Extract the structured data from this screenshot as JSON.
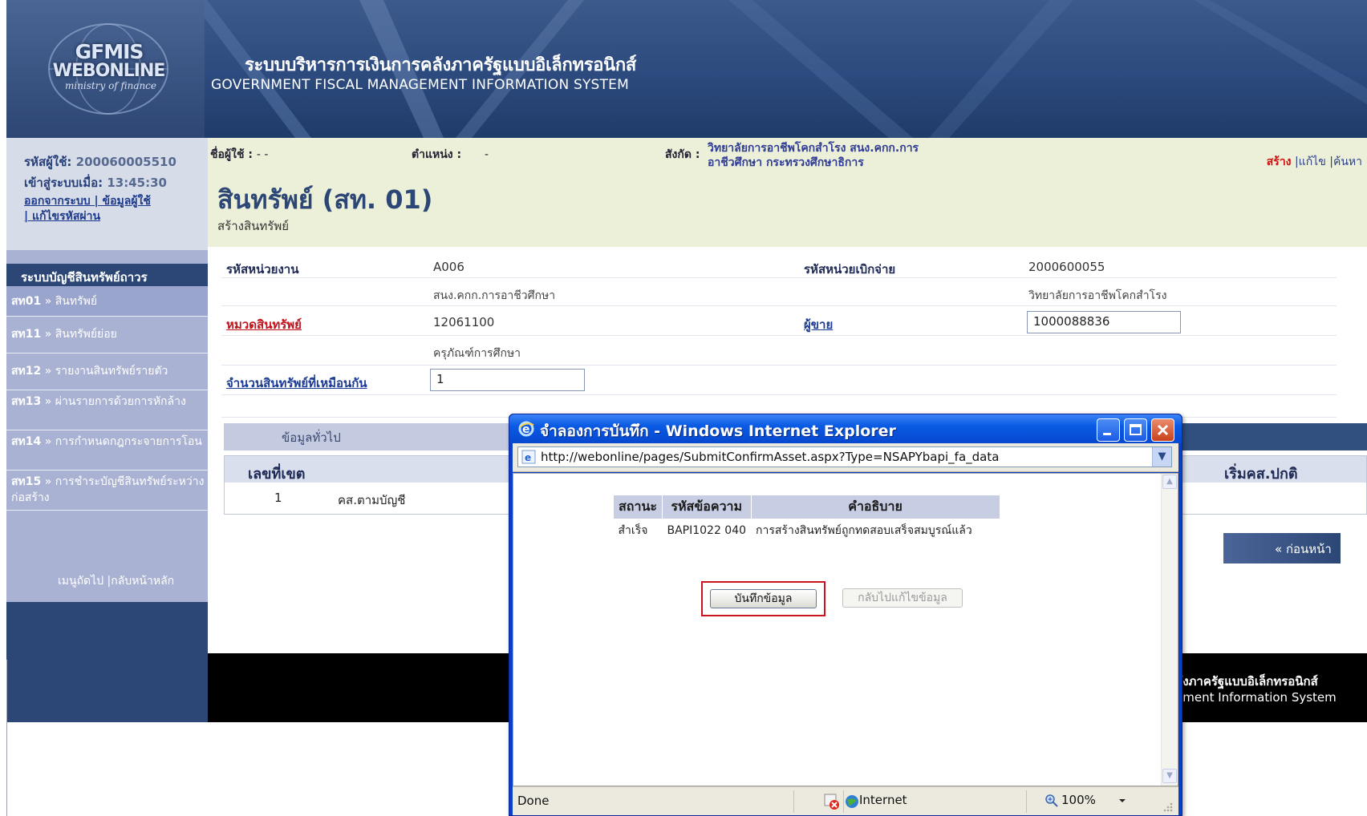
{
  "header": {
    "logo_line1": "GFMIS",
    "logo_line2": "WEBONLINE",
    "logo_line3": "ministry of finance",
    "system_title_th": "ระบบบริหารการเงินการคลังภาครัฐแบบอิเล็กทรอนิกส์",
    "system_title_en": "GOVERNMENT FISCAL MANAGEMENT INFORMATION SYSTEM"
  },
  "sidebar": {
    "user_id_label": "รหัสผู้ใช้:",
    "user_id": "200060005510",
    "login_label": "เข้าสู่ระบบเมื่อ:",
    "login_time": "13:45:30",
    "links_line1": "ออกจากระบบ | ข้อมูลผู้ใช้",
    "links_line2": "| แก้ไขรหัสผ่าน",
    "section_title": "ระบบบัญชีสินทรัพย์ถาวร",
    "items": [
      {
        "code": "สท01",
        "sep": " » ",
        "label": "สินทรัพย์"
      },
      {
        "code": "สท11",
        "sep": " » ",
        "label": "สินทรัพย์ย่อย"
      },
      {
        "code": "สท12",
        "sep": " » ",
        "label": "รายงานสินทรัพย์รายตัว"
      },
      {
        "code": "สท13",
        "sep": " » ",
        "label": "ผ่านรายการด้วยการหักล้าง"
      },
      {
        "code": "สท14",
        "sep": " » ",
        "label": "การกำหนดกฎกระจายการโอน"
      },
      {
        "code": "สท15",
        "sep": " » ",
        "label": "การชำระบัญชีสินทรัพย์ระหว่างก่อสร้าง"
      }
    ],
    "bottom_links": "เมนูถัดไป |กลับหน้าหลัก"
  },
  "userbar": {
    "username_label": "ชื่อผู้ใช้ :",
    "username_value": "- -",
    "position_label": "ตำแหน่ง :",
    "position_value": "-",
    "org_label": "สังกัด :",
    "org_line1": "วิทยาลัยการอาชีพโคกสำโรง สนง.คกก.การ",
    "org_line2": "อาชีวศึกษา กระทรวงศึกษาธิการ",
    "action_create": "สร้าง",
    "action_rest": " |แก้ไข |ค้นหา"
  },
  "page": {
    "title": "สินทรัพย์ (สท. 01)",
    "subtitle": "สร้างสินทรัพย์"
  },
  "form": {
    "agency_label": "รหัสหน่วยงาน",
    "agency_code": "A006",
    "agency_name": "สนง.คกก.การอาชีวศึกษา",
    "disb_label": "รหัสหน่วยเบิกจ่าย",
    "disb_code": "2000600055",
    "disb_name": "วิทยาลัยการอาชีพโคกสำโรง",
    "category_label": "หมวดสินทรัพย์",
    "category_code": "12061100",
    "category_name": "ครุภัณฑ์การศึกษา",
    "vendor_label": "ผู้ขาย",
    "vendor_value": "1000088836",
    "same_count_label": "จำนวนสินทรัพย์ที่เหมือนกัน",
    "same_count_value": "1"
  },
  "tabs": {
    "general": "ข้อมูลทั่วไป"
  },
  "grid": {
    "col_area": "เลขที่เขต",
    "col_start": "เริ่มคส.ปกติ",
    "row_area": "1",
    "row_desc": "คส.ตามบัญชี"
  },
  "nav": {
    "prev": "« ก่อนหน้า"
  },
  "footer": {
    "th": "ลังภาครัฐแบบอิเล็กทรอนิกส์",
    "en": "ement Information System"
  },
  "dialog": {
    "title": "จำลองการบันทึก - Windows Internet Explorer",
    "url": "http://webonline/pages/SubmitConfirmAsset.aspx?Type=NSAPYbapi_fa_data",
    "table_headers": [
      "สถานะ",
      "รหัสข้อความ",
      "คำอธิบาย"
    ],
    "table_rows": [
      [
        "สำเร็จ",
        "BAPI1022 040",
        "การสร้างสินทรัพย์ถูกทดสอบเสร็จสมบูรณ์แล้ว"
      ]
    ],
    "save_button": "บันทึกข้อมูล",
    "back_button": "กลับไปแก้ไขข้อมูล",
    "status_done": "Done",
    "status_zone": "Internet",
    "status_zoom": "100%"
  }
}
